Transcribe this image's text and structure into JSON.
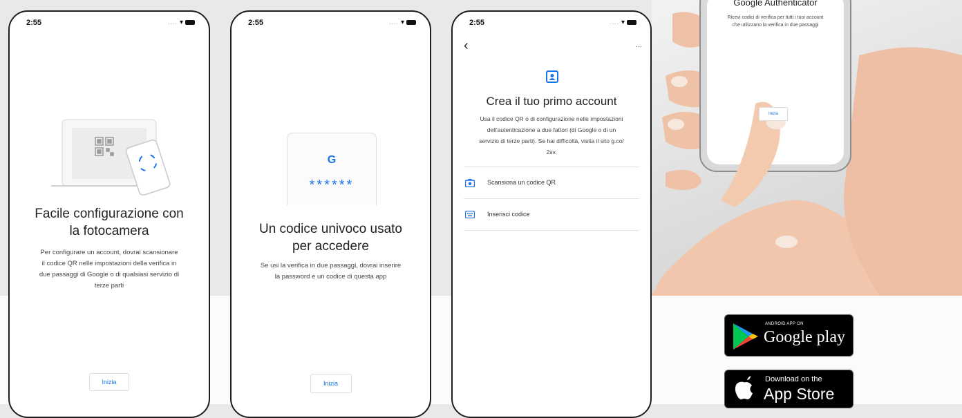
{
  "phone1": {
    "time": "2:55",
    "title_line1": "Facile configurazione con",
    "title_line2": "la fotocamera",
    "body_lines": [
      "Per configurare un account, dovrai scansionare",
      "il codice QR nelle impostazioni della verifica in",
      "due passaggi di Google o di qualsiasi servizio di",
      "terze parti"
    ],
    "button": "Inizia"
  },
  "phone2": {
    "time": "2:55",
    "g_logo": "G",
    "code_mask": "******",
    "title_line1": "Un codice univoco usato",
    "title_line2": "per accedere",
    "body_lines": [
      "Se usi la verifica in due passaggi, dovrai inserire",
      "la password e un codice di questa app"
    ],
    "button": "Inizia"
  },
  "phone3": {
    "time": "2:55",
    "more": "...",
    "title": "Crea il tuo primo account",
    "body_lines": [
      "Usa il codice QR o di configurazione nelle impostazioni",
      "dell'autenticazione a due fattori (di Google o di un",
      "servizio di terze parti). Se hai difficoltà, visita il sito g.co/",
      "2sv."
    ],
    "options": [
      "Scansiona un codice QR",
      "Inserisci codice"
    ]
  },
  "photo": {
    "title": "Google Authenticator",
    "body_lines": [
      "Ricevi codici di verifica per tutti i tuoi account",
      "che utilizzano la verifica in due passaggi"
    ],
    "button": "Inizia"
  },
  "google_play": {
    "small": "ANDROID APP ON",
    "main": "Google play"
  },
  "app_store": {
    "small": "Download on the",
    "main": "App Store"
  },
  "colors": {
    "accent": "#1a73e8",
    "play_green": "#00c853",
    "play_red": "#f44336",
    "play_yellow": "#ffc107"
  }
}
